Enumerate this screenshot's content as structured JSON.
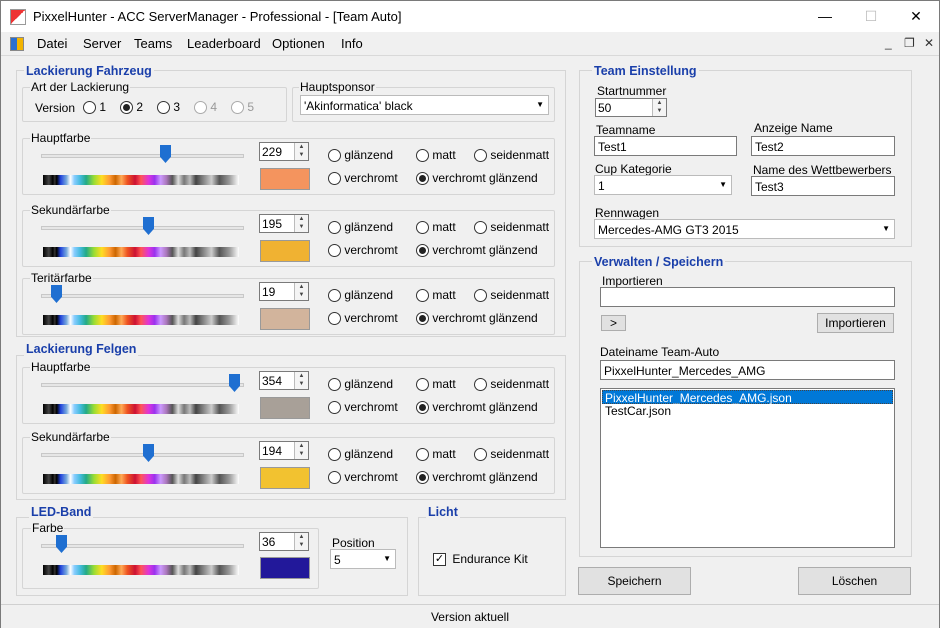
{
  "window": {
    "title": "PixxelHunter - ACC ServerManager  - Professional - [Team Auto]",
    "minimize": "—",
    "maximize": "☐",
    "close": "✕"
  },
  "menu": [
    "Datei",
    "Server",
    "Teams",
    "Leaderboard",
    "Optionen",
    "Info"
  ],
  "mdi": {
    "minimize": "_",
    "restore": "❐",
    "close": "✕"
  },
  "vehicle": {
    "title": "Lackierung Fahrzeug",
    "art_label": "Art der Lackierung",
    "version_label": "Version",
    "versions": [
      "1",
      "2",
      "3",
      "4",
      "5"
    ],
    "version_selected": "2",
    "sponsor_label": "Hauptsponsor",
    "sponsor_value": "'Akinformatica' black"
  },
  "finish_labels": {
    "glossy": "glänzend",
    "matte": "matt",
    "satin": "seidenmatt",
    "chrome": "verchromt",
    "chrome_glossy": "verchromt glänzend"
  },
  "colors": [
    {
      "title": "Hauptfarbe",
      "value": "229",
      "swatch": "#f4945e",
      "slider": 0.62
    },
    {
      "title": "Sekundärfarbe",
      "value": "195",
      "swatch": "#f0b232",
      "slider": 0.53
    },
    {
      "title": "Teritärfarbe",
      "value": "19",
      "swatch": "#d2b49c",
      "slider": 0.05
    }
  ],
  "rims": {
    "title": "Lackierung Felgen",
    "colors": [
      {
        "title": "Hauptfarbe",
        "value": "354",
        "swatch": "#a8a098",
        "slider": 0.98
      },
      {
        "title": "Sekundärfarbe",
        "value": "194",
        "swatch": "#f2c230",
        "slider": 0.53
      }
    ]
  },
  "led": {
    "title": "LED-Band",
    "farbe_label": "Farbe",
    "value": "36",
    "swatch": "#22189a",
    "slider": 0.08,
    "position_label": "Position",
    "position_value": "5"
  },
  "light": {
    "title": "Licht",
    "endurance_label": "Endurance Kit",
    "endurance_checked": true,
    "check": "✓"
  },
  "team": {
    "title": "Team Einstellung",
    "startnummer_label": "Startnummer",
    "startnummer": "50",
    "teamname_label": "Teamname",
    "teamname": "Test1",
    "anzeige_label": "Anzeige Name",
    "anzeige": "Test2",
    "cup_label": "Cup Kategorie",
    "cup": "1",
    "wettbewerber_label": "Name des Wettbewerbers",
    "wettbewerber": "Test3",
    "rennwagen_label": "Rennwagen",
    "rennwagen": "Mercedes-AMG GT3 2015"
  },
  "manage": {
    "title": "Verwalten / Speichern",
    "import_label": "Importieren",
    "import_value": "",
    "arrow_button": ">",
    "import_button": "Importieren",
    "filename_label": "Dateiname Team-Auto",
    "filename": "PixxelHunter_Mercedes_AMG",
    "files": [
      "PixxelHunter_Mercedes_AMG.json",
      "TestCar.json"
    ]
  },
  "buttons": {
    "save": "Speichern",
    "delete": "Löschen"
  },
  "status": "Version aktuell",
  "accent": "#1a3faa"
}
